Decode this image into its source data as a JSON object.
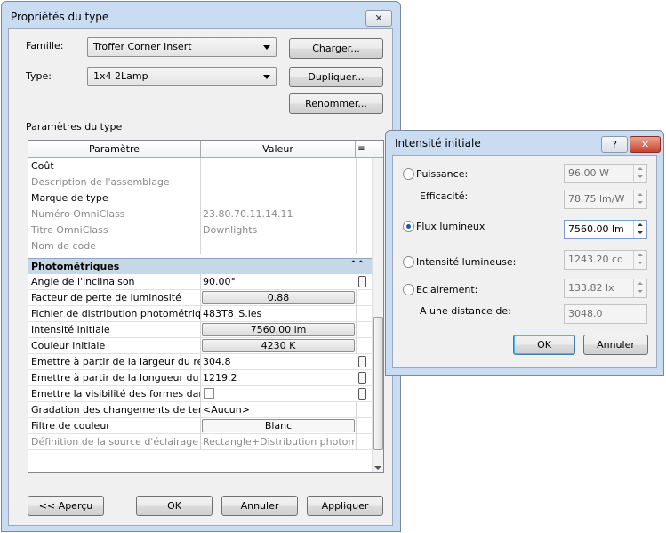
{
  "main_dialog": {
    "title": "Propriétés du type",
    "close_glyph": "✕",
    "family_label": "Famille:",
    "family_value": "Troffer Corner Insert",
    "type_label": "Type:",
    "type_value": "1x4 2Lamp",
    "load_button": "Charger...",
    "duplicate_button": "Dupliquer...",
    "rename_button": "Renommer...",
    "section_label": "Paramètres du type",
    "grid": {
      "col_param": "Paramètre",
      "col_value": "Valeur",
      "menu_glyph": "≡",
      "rows_top": [
        {
          "name": "Coût",
          "value": ""
        },
        {
          "name": "Description de l'assemblage",
          "value": ""
        },
        {
          "name": "Marque de type",
          "value": ""
        },
        {
          "name": "Numéro OmniClass",
          "value": "23.80.70.11.14.11"
        },
        {
          "name": "Titre OmniClass",
          "value": "Downlights"
        },
        {
          "name": "Nom de code",
          "value": ""
        }
      ],
      "group_label": "Photométriques",
      "group_glyph": "⌃⌃",
      "rows_photo": [
        {
          "name": "Angle de l'inclinaison",
          "value": "90.00°"
        },
        {
          "name": "Facteur de perte de luminosité",
          "value": "0.88"
        },
        {
          "name": "Fichier de distribution photométrique",
          "value": "483T8_S.ies"
        },
        {
          "name": "Intensité initiale",
          "value": "7560.00 lm"
        },
        {
          "name": "Couleur initiale",
          "value": "4230 K"
        },
        {
          "name": "Emettre à partir de la largeur du rectangle",
          "value": "304.8"
        },
        {
          "name": "Emettre à partir de la longueur du rectangle",
          "value": "1219.2"
        },
        {
          "name": "Emettre la visibilité des formes dans",
          "value": ""
        },
        {
          "name": "Gradation des changements de température",
          "value": "<Aucun>"
        },
        {
          "name": "Filtre de couleur",
          "value": "Blanc"
        },
        {
          "name": "Définition de la source d'éclairage (famille)",
          "value": "Rectangle+Distribution photom"
        }
      ]
    },
    "preview_button": "<< Aperçu",
    "ok_button": "OK",
    "cancel_button": "Annuler",
    "apply_button": "Appliquer"
  },
  "intensity_dialog": {
    "title": "Intensité initiale",
    "help_glyph": "?",
    "close_glyph": "✕",
    "power_label": "Puissance:",
    "power_value": "96.00 W",
    "efficacy_label": "Efficacité:",
    "efficacy_value": "78.75 lm/W",
    "flux_label": "Flux lumineux",
    "flux_value": "7560.00 lm",
    "luminous_intensity_label": "Intensité lumineuse:",
    "luminous_intensity_value": "1243.20 cd",
    "illuminance_label": "Eclairement:",
    "illuminance_value": "133.82 lx",
    "distance_label": "A une distance de:",
    "distance_value": "3048.0",
    "ok_button": "OK",
    "cancel_button": "Annuler",
    "selected_option": "flux"
  }
}
